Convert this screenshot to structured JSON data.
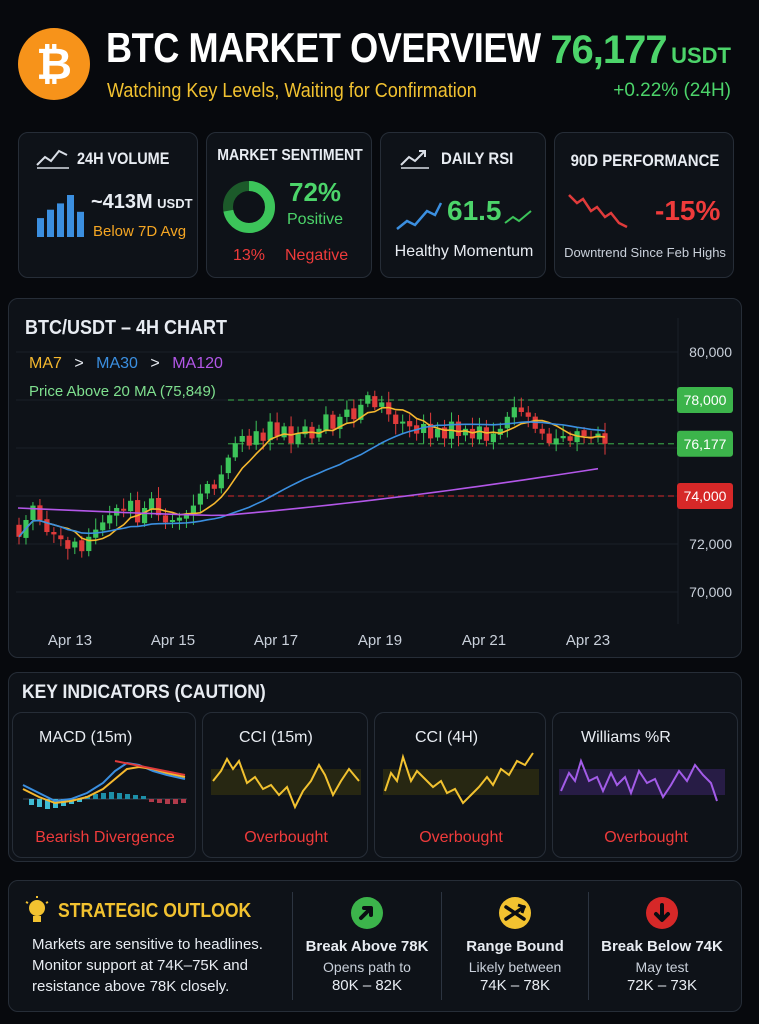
{
  "header": {
    "title": "BTC MARKET OVERVIEW",
    "subtitle": "Watching Key Levels, Waiting for Confirmation",
    "price": "76,177",
    "price_unit": "USDT",
    "change": "+0.22% (24H)",
    "logo_glyph": "₿",
    "logo_color": "#f7931a"
  },
  "stats": {
    "volume": {
      "title": "24H VOLUME",
      "value": "~413M",
      "unit": "USDT",
      "note": "Below 7D Avg",
      "bars": [
        0.45,
        0.65,
        0.8,
        1.0,
        0.6
      ]
    },
    "sentiment": {
      "title": "MARKET SENTIMENT",
      "positive_pct": "72%",
      "positive_label": "Positive",
      "negative_pct": "13%",
      "negative_label": "Negative",
      "positive_fraction": 0.72
    },
    "rsi": {
      "title": "DAILY RSI",
      "value": "61.5",
      "note": "Healthy Momentum"
    },
    "performance": {
      "title": "90D PERFORMANCE",
      "value": "-15%",
      "note": "Downtrend Since Feb Highs"
    }
  },
  "chart_title": "BTC/USDT – 4H CHART",
  "ma_legend": {
    "ma7": "MA7",
    "gt1": ">",
    "ma30": "MA30",
    "gt2": ">",
    "ma120": "MA120",
    "note": "Price Above 20 MA (75,849)"
  },
  "chart_data": {
    "type": "candlestick",
    "x_labels": [
      "Apr 13",
      "Apr 15",
      "Apr 17",
      "Apr 19",
      "Apr 21",
      "Apr 23"
    ],
    "y_ticks": [
      "80,000",
      "78,000",
      "76,000",
      "74,000",
      "72,000",
      "70,000"
    ],
    "ylim": [
      69500,
      80500
    ],
    "levels": [
      {
        "label": "78,000",
        "value": 78000,
        "color": "#3cb44b"
      },
      {
        "label": "76,177",
        "value": 76177,
        "color": "#3cb44b"
      },
      {
        "label": "74,000",
        "value": 74000,
        "color": "#d62828"
      }
    ],
    "colors": {
      "up": "#3cc45a",
      "down": "#e03b3b",
      "ma7": "#f5b82e",
      "ma30": "#3b8fe0",
      "ma120": "#b357e8"
    },
    "closes": [
      72300,
      73000,
      73600,
      73000,
      72500,
      72400,
      72200,
      71800,
      72100,
      71700,
      72300,
      72600,
      72900,
      73200,
      73500,
      73400,
      73800,
      72900,
      73500,
      73900,
      73200,
      72900,
      73000,
      73100,
      73200,
      73600,
      74100,
      74500,
      74300,
      74900,
      75600,
      76200,
      76500,
      76100,
      76700,
      76300,
      77100,
      76500,
      76900,
      76200,
      76600,
      76900,
      76400,
      76800,
      77400,
      76800,
      77300,
      77600,
      77200,
      77800,
      78200,
      77700,
      77900,
      77400,
      77000,
      77100,
      76900,
      76600,
      77000,
      76400,
      76800,
      76400,
      77100,
      76500,
      76800,
      76400,
      76900,
      76300,
      76600,
      76800,
      77300,
      77700,
      77500,
      77300,
      76800,
      76600,
      76200,
      76400,
      76500,
      76300,
      76700,
      76500,
      76400,
      76600,
      76177
    ]
  },
  "key_indicators": {
    "title": "KEY INDICATORS (CAUTION)",
    "items": [
      {
        "name": "MACD (15m)",
        "status": "Bearish Divergence"
      },
      {
        "name": "CCI (15m)",
        "status": "Overbought"
      },
      {
        "name": "CCI (4H)",
        "status": "Overbought"
      },
      {
        "name": "Williams %R",
        "status": "Overbought"
      }
    ]
  },
  "outlook": {
    "title": "STRATEGIC OUTLOOK",
    "text": [
      "Markets are sensitive to headlines.",
      "Monitor support at 74K–75K and",
      "resistance above 78K closely."
    ],
    "scenarios": [
      {
        "title": "Break Above 78K",
        "line1": "Opens path to",
        "line2": "80K – 82K",
        "icon": "arrow-up-right-icon",
        "color": "#3cb44b"
      },
      {
        "title": "Range Bound",
        "line1": "Likely between",
        "line2": "74K – 78K",
        "icon": "range-arrows-icon",
        "color": "#f2c230"
      },
      {
        "title": "Break Below 74K",
        "line1": "May test",
        "line2": "72K – 73K",
        "icon": "arrow-down-icon",
        "color": "#d62828"
      }
    ]
  }
}
